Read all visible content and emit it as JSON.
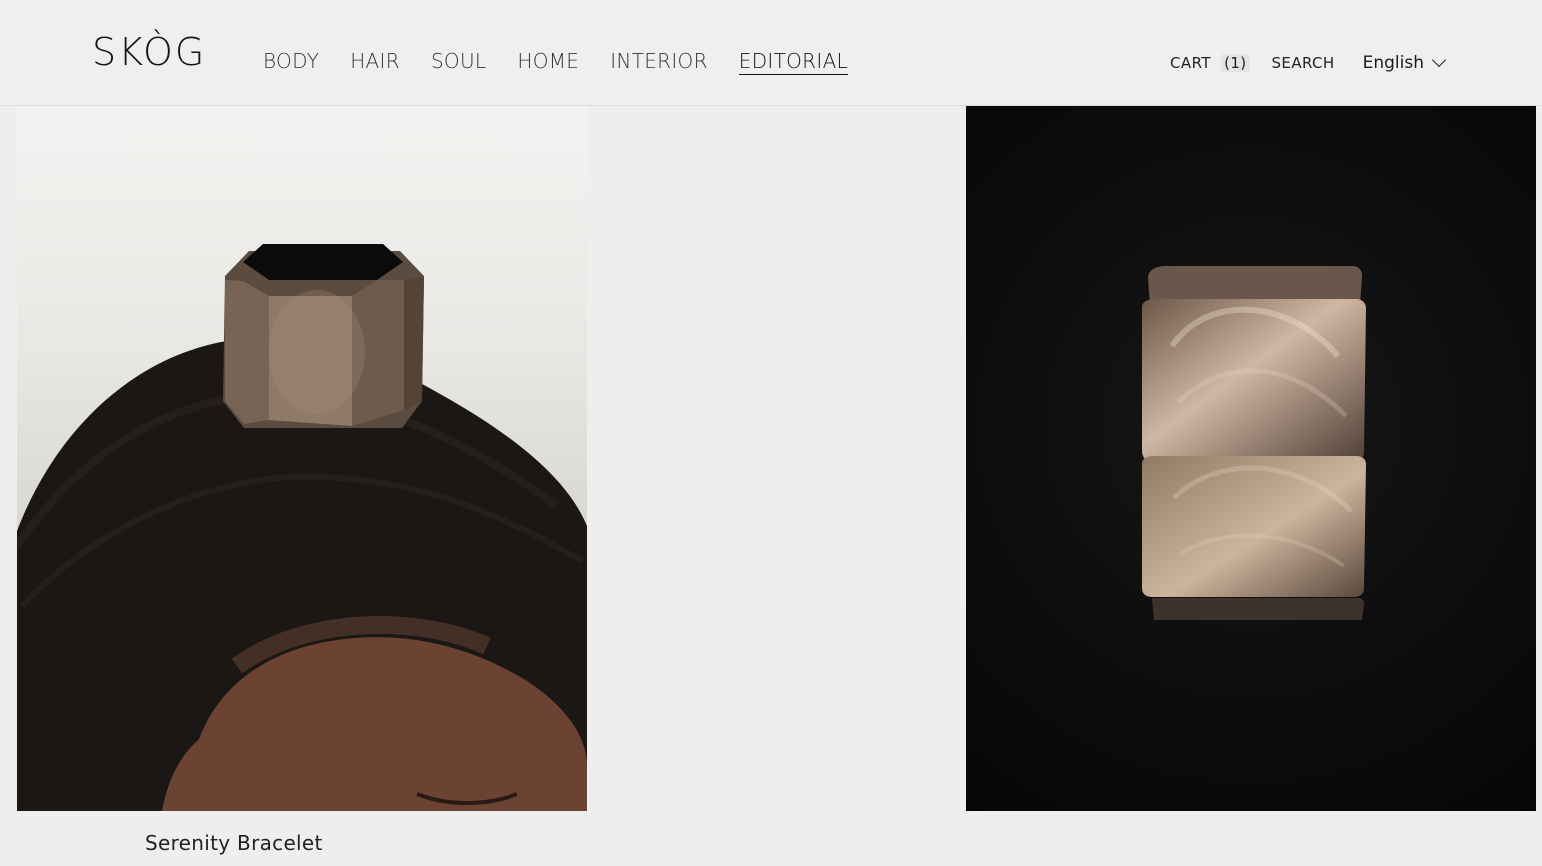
{
  "brand": {
    "name": "SKÒG"
  },
  "nav": {
    "items": [
      {
        "label": "BODY"
      },
      {
        "label": "HAIR"
      },
      {
        "label": "SOUL"
      },
      {
        "label": "HOME"
      },
      {
        "label": "INTERIOR"
      },
      {
        "label": "EDITORIAL",
        "active": true
      }
    ]
  },
  "header": {
    "cart_label": "CART",
    "cart_count": "(1)",
    "search_label": "SEARCH",
    "language": "English"
  },
  "product": {
    "title": "Serenity Bracelet"
  }
}
